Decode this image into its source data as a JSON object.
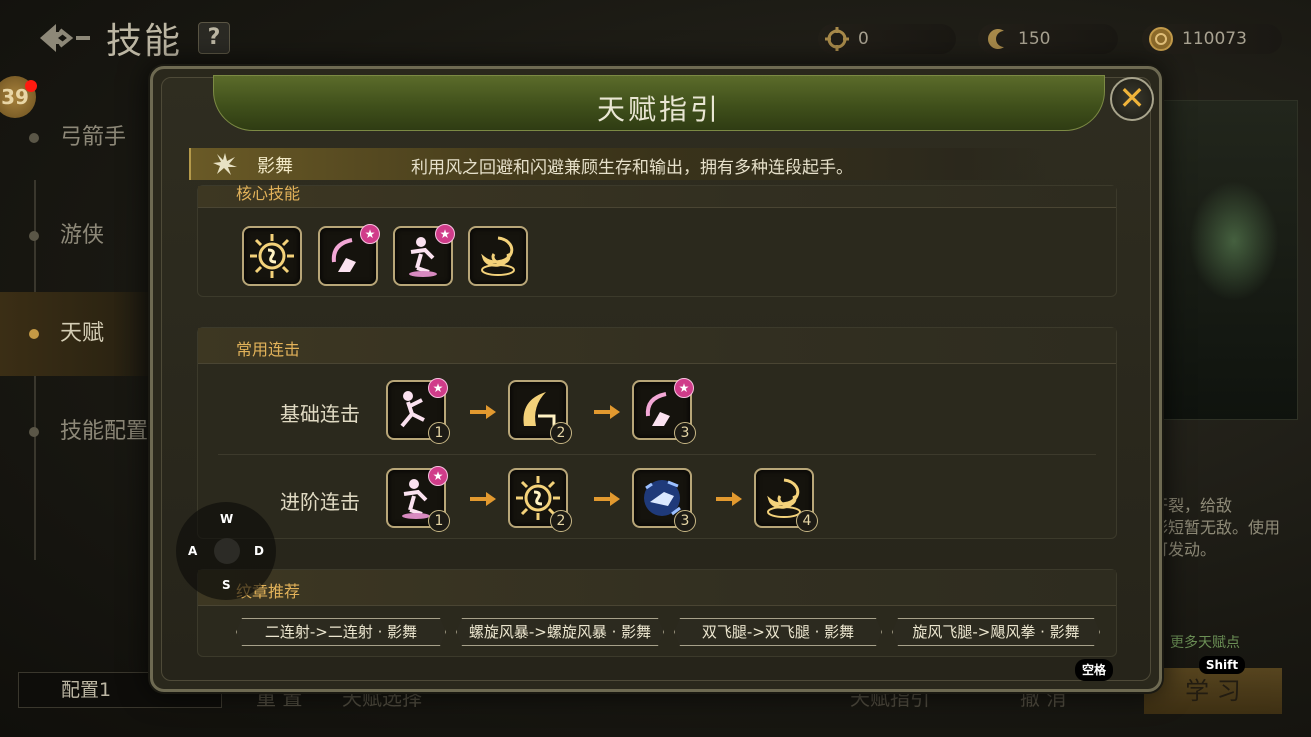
{
  "header": {
    "title": "技能",
    "help": "?",
    "currencies": [
      {
        "icon": "gear-token-icon",
        "value": "0"
      },
      {
        "icon": "crescent-token-icon",
        "value": "150"
      },
      {
        "icon": "gold-coin-icon",
        "value": "110073"
      }
    ]
  },
  "sidebar": {
    "level": "39",
    "items": [
      {
        "label": "弓箭手"
      },
      {
        "label": "游侠"
      },
      {
        "label": "天赋"
      },
      {
        "label": "技能配置"
      }
    ],
    "config": "配置1"
  },
  "background": {
    "desc_lines": [
      "地面开裂，给敌",
      "依次彩短暂无敌。使用",
      "即即可发动。"
    ],
    "more_talents": "更多天赋点",
    "learn_button": "学 习",
    "shift_hint": "Shift",
    "bottom_tabs": [
      "重 置",
      "天赋选择",
      "天赋指引",
      "撤 消"
    ]
  },
  "modal": {
    "title": "天赋指引",
    "close": "✕",
    "class": {
      "name": "影舞",
      "description": "利用风之回避和闪避兼顾生存和输出，拥有多种连段起手。"
    },
    "core_skills": {
      "title": "核心技能",
      "skills": [
        {
          "icon": "sun-burst-icon"
        },
        {
          "icon": "spin-kick-icon",
          "star": "★"
        },
        {
          "icon": "dash-kick-icon",
          "star": "★"
        },
        {
          "icon": "whirlwind-icon"
        }
      ]
    },
    "combos": {
      "title": "常用连击",
      "rows": [
        {
          "label": "基础连击",
          "steps": [
            {
              "icon": "leap-kick-icon",
              "num": "1",
              "star": "★"
            },
            {
              "icon": "crescent-slash-icon",
              "num": "2"
            },
            {
              "icon": "spin-kick-icon",
              "num": "3",
              "star": "★"
            }
          ]
        },
        {
          "label": "进阶连击",
          "steps": [
            {
              "icon": "dash-kick-icon",
              "num": "1",
              "star": "★"
            },
            {
              "icon": "sun-burst-icon",
              "num": "2"
            },
            {
              "icon": "wind-fist-icon",
              "num": "3"
            },
            {
              "icon": "whirlwind-icon",
              "num": "4"
            }
          ]
        }
      ]
    },
    "emblems": {
      "title": "纹章推荐",
      "items": [
        "二连射->二连射 · 影舞",
        "螺旋风暴->螺旋风暴 · 影舞",
        "双飞腿->双飞腿 · 影舞",
        "旋风飞腿->飓风拳 · 影舞"
      ]
    },
    "space_hint": "空格"
  },
  "wasd": {
    "up": "W",
    "left": "A",
    "right": "D",
    "down": "S"
  },
  "colors": {
    "accent_gold": "#e2b25a",
    "header_green": "#4c5c21",
    "star_pink": "#d03c8a"
  }
}
